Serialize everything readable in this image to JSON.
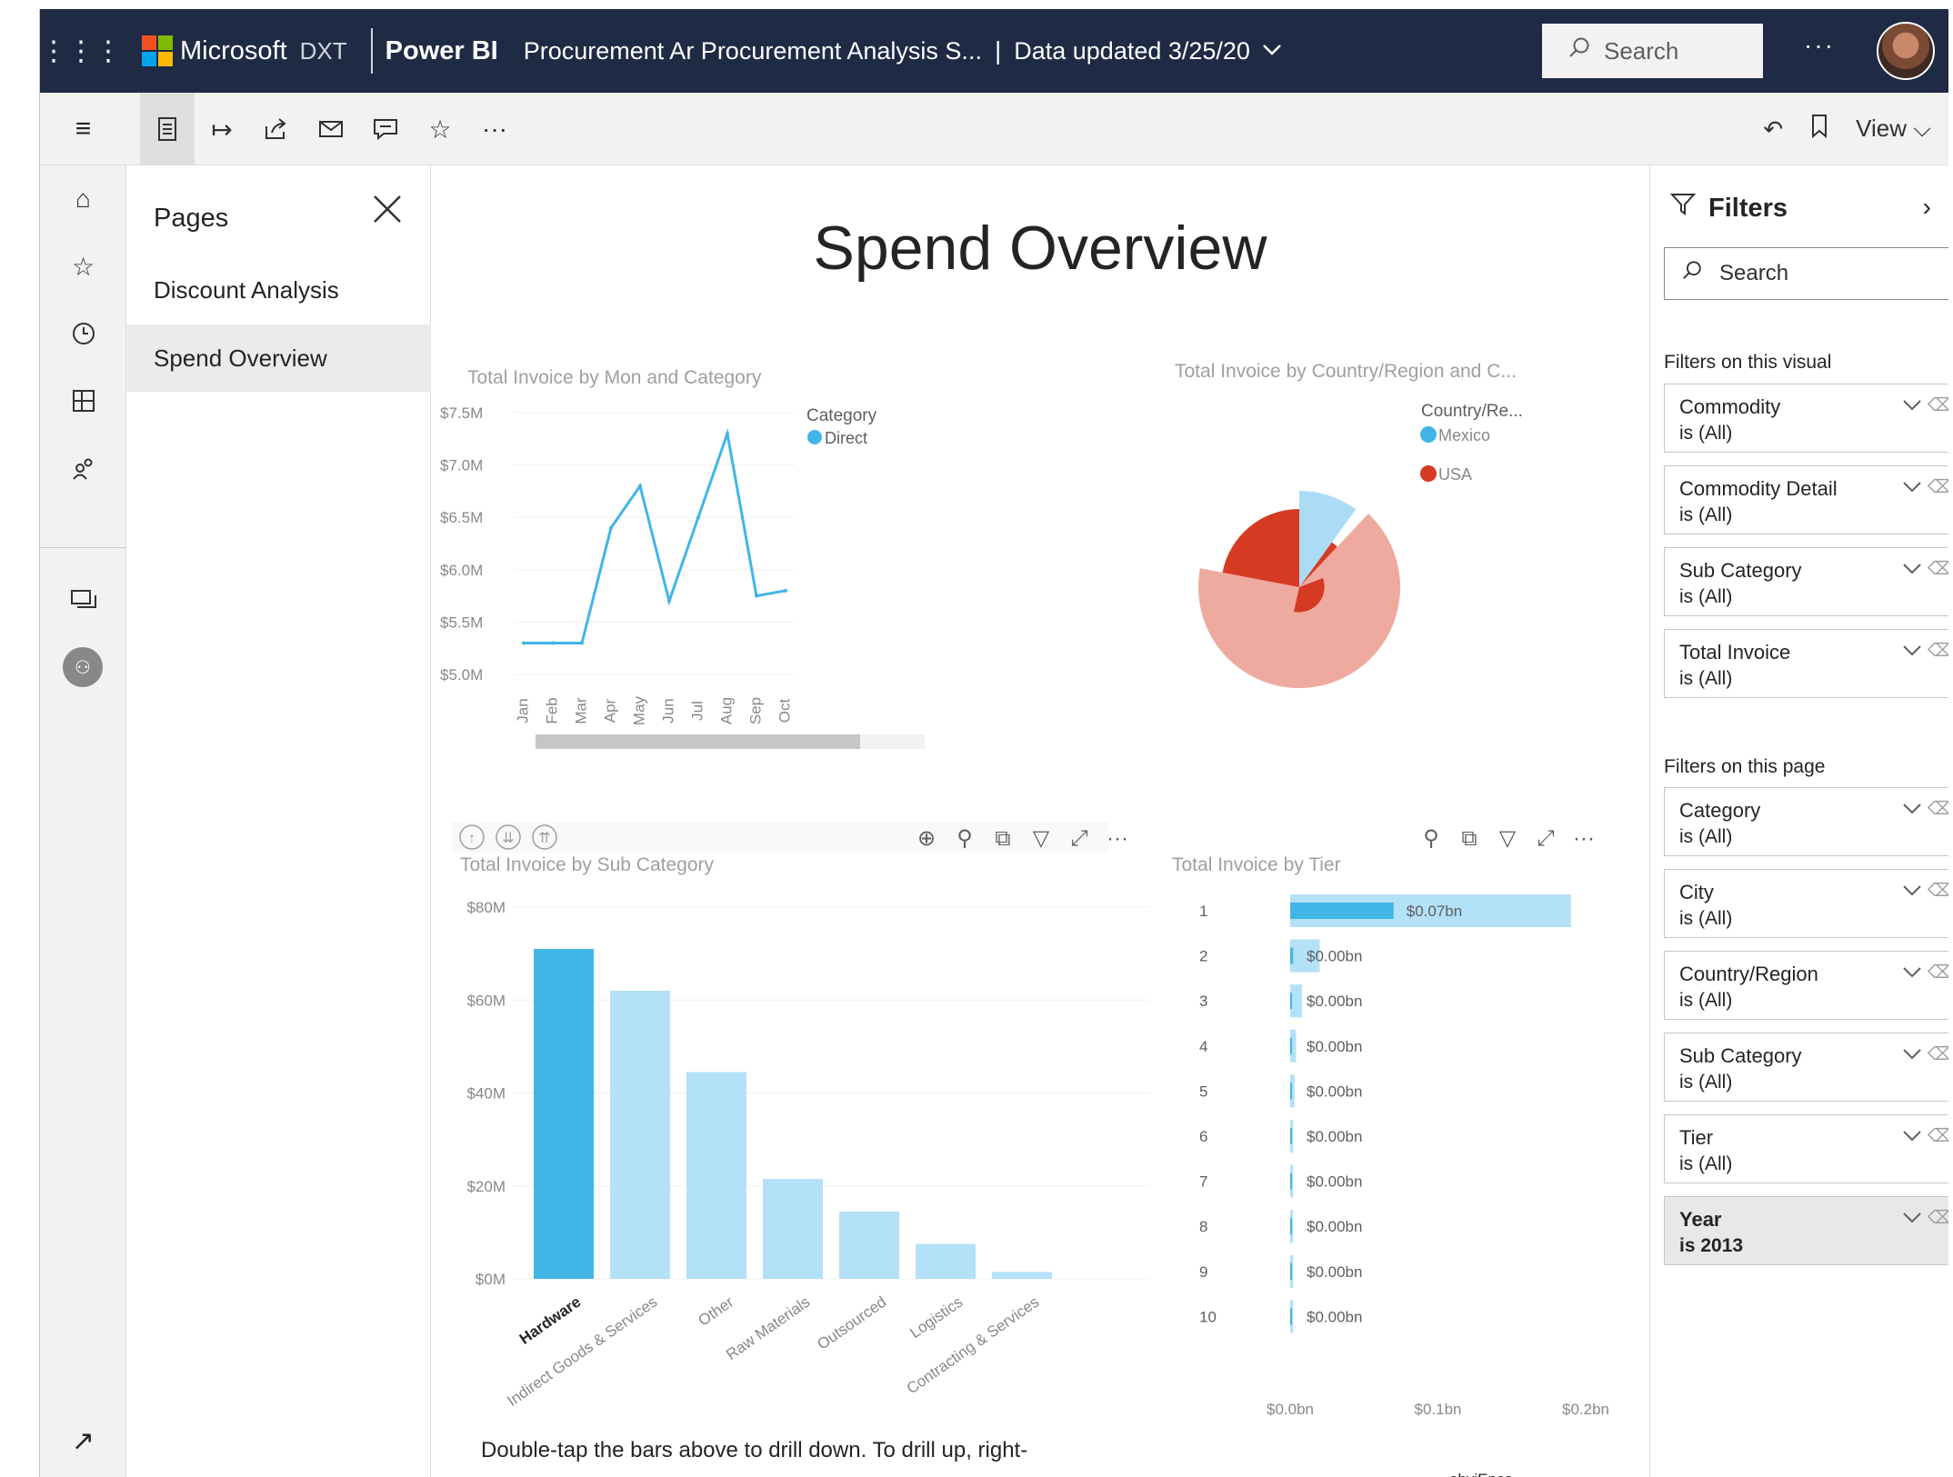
{
  "header": {
    "microsoft": "Microsoft",
    "dxt": "DXT",
    "powerbi": "Power BI",
    "report_name": "Procurement Ar Procurement Analysis S...",
    "separator": "|",
    "data_updated": "Data updated 3/25/20",
    "search_placeholder": "Search",
    "more": "···",
    "ms_colors": [
      "#f25022",
      "#7fba00",
      "#00a4ef",
      "#ffb900"
    ]
  },
  "toolbar": {
    "view_label": "View"
  },
  "pages": {
    "title": "Pages",
    "items": [
      "Discount Analysis",
      "Spend Overview"
    ],
    "active_index": 1
  },
  "report": {
    "title": "Spend Overview",
    "line_title": "Total Invoice by Mon and Category",
    "pie_title": "Total Invoice by Country/Region and C...",
    "bar_title": "Total Invoice by Sub Category",
    "tier_title": "Total Invoice by Tier",
    "drill_text": "Double-tap the bars above to drill down. To drill up, right-",
    "watermark": "obviEnce"
  },
  "colors": {
    "line": "#41b6e6",
    "bar_dark": "#41b6e6",
    "bar_light": "#b3e1f7",
    "pie_mexico": "#aadcf5",
    "pie_usa_light": "#efaaa0",
    "pie_usa_dark": "#d63a22"
  },
  "chart_data": [
    {
      "type": "line",
      "title": "Total Invoice by Mon and Category",
      "categories": [
        "Jan",
        "Feb",
        "Mar",
        "Apr",
        "May",
        "Jun",
        "Jul",
        "Aug",
        "Sep",
        "Oct"
      ],
      "series": [
        {
          "name": "Direct",
          "values": [
            5.3,
            5.3,
            5.3,
            6.4,
            6.8,
            5.7,
            6.5,
            7.3,
            5.75,
            5.8
          ]
        }
      ],
      "yticks": [
        "$7.5M",
        "$7.0M",
        "$6.5M",
        "$6.0M",
        "$5.5M",
        "$5.0M"
      ],
      "ylim": [
        5.0,
        7.5
      ],
      "legend_title": "Category",
      "legend": [
        "Direct"
      ]
    },
    {
      "type": "pie",
      "title": "Total Invoice by Country/Region and C...",
      "legend_title": "Country/Re...",
      "legend": [
        "Mexico",
        "USA"
      ],
      "slices": [
        {
          "name": "Mexico",
          "value": 10
        },
        {
          "name": "USA",
          "value": 2
        },
        {
          "name": "USA",
          "value": 66
        },
        {
          "name": "USA",
          "value": 22
        }
      ]
    },
    {
      "type": "bar",
      "title": "Total Invoice by Sub Category",
      "categories": [
        "Hardware",
        "Indirect Goods & Services",
        "Other",
        "Raw Materials",
        "Outsourced",
        "Logistics",
        "Contracting & Services"
      ],
      "values": [
        71,
        62,
        44.5,
        21.5,
        14.5,
        7.5,
        1.5
      ],
      "highlighted": [
        true,
        false,
        false,
        false,
        false,
        false,
        false
      ],
      "yticks": [
        "$80M",
        "$60M",
        "$40M",
        "$20M",
        "$0M"
      ],
      "ylim": [
        0,
        80
      ]
    },
    {
      "type": "bar",
      "orientation": "horizontal",
      "title": "Total Invoice by Tier",
      "categories": [
        "1",
        "2",
        "3",
        "4",
        "5",
        "6",
        "7",
        "8",
        "9",
        "10"
      ],
      "values": [
        0.07,
        0.002,
        0.001,
        0.0008,
        0.0005,
        0.0004,
        0.0003,
        0.0003,
        0.0002,
        0.0002
      ],
      "background_values": [
        0.19,
        0.02,
        0.008,
        0.004,
        0.003,
        0.002,
        0.002,
        0.002,
        0.002,
        0.002
      ],
      "labels": [
        "$0.07bn",
        "$0.00bn",
        "$0.00bn",
        "$0.00bn",
        "$0.00bn",
        "$0.00bn",
        "$0.00bn",
        "$0.00bn",
        "$0.00bn",
        "$0.00bn"
      ],
      "xticks": [
        "$0.0bn",
        "$0.1bn",
        "$0.2bn"
      ],
      "xlim": [
        0,
        0.2
      ]
    }
  ],
  "filters": {
    "title": "Filters",
    "search_placeholder": "Search",
    "visual_section": "Filters on this visual",
    "page_section": "Filters on this page",
    "visual": [
      {
        "name": "Commodity",
        "value": "is (All)"
      },
      {
        "name": "Commodity Detail",
        "value": "is (All)"
      },
      {
        "name": "Sub Category",
        "value": "is (All)"
      },
      {
        "name": "Total Invoice",
        "value": "is (All)"
      }
    ],
    "page": [
      {
        "name": "Category",
        "value": "is (All)"
      },
      {
        "name": "City",
        "value": "is (All)"
      },
      {
        "name": "Country/Region",
        "value": "is (All)"
      },
      {
        "name": "Sub Category",
        "value": "is (All)"
      },
      {
        "name": "Tier",
        "value": "is (All)"
      },
      {
        "name": "Year",
        "value": "is 2013"
      }
    ]
  }
}
